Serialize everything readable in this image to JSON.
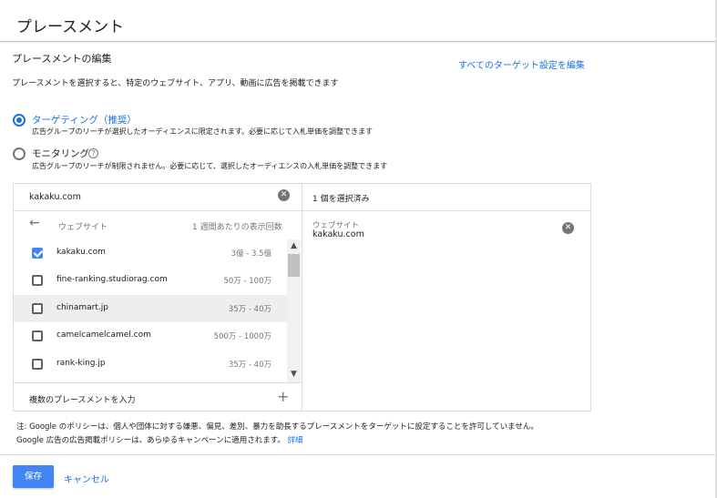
{
  "header": {
    "title": "プレースメント"
  },
  "section": {
    "heading": "プレースメントの編集",
    "edit_all_link": "すべてのターゲット設定を編集",
    "description": "プレースメントを選択すると、特定のウェブサイト、アプリ、動画に広告を掲載できます"
  },
  "targeting": {
    "options": [
      {
        "label": "ターゲティング（推奨）",
        "help": "広告グループのリーチが選択したオーディエンスに限定されます。必要に応じて入札単価を調整できます",
        "selected": true
      },
      {
        "label": "モニタリング",
        "help": "広告グループのリーチが制限されません。必要に応じて、選択したオーディエンスの入札単価を調整できます",
        "selected": false
      }
    ]
  },
  "search": {
    "value": "kakaku.com"
  },
  "results": {
    "column_website": "ウェブサイト",
    "column_impressions": "1 週間あたりの表示回数",
    "rows": [
      {
        "name": "kakaku.com",
        "impressions": "3億 - 3.5億",
        "checked": true
      },
      {
        "name": "fine-ranking.studiorag.com",
        "impressions": "50万 - 100万",
        "checked": false
      },
      {
        "name": "chinamart.jp",
        "impressions": "35万 - 40万",
        "checked": false
      },
      {
        "name": "camelcamelcamel.com",
        "impressions": "500万 - 1000万",
        "checked": false
      },
      {
        "name": "rank-king.jp",
        "impressions": "35万 - 40万",
        "checked": false
      }
    ],
    "multi_input_label": "複数のプレースメントを入力"
  },
  "selected": {
    "count_label": "1 個を選択済み",
    "items": [
      {
        "type": "ウェブサイト",
        "value": "kakaku.com"
      }
    ]
  },
  "notes": {
    "line1": "注: Google のポリシーは、個人や団体に対する嫌悪、偏見、差別、暴力を助長するプレースメントをターゲットに設定することを許可していません。",
    "line2": "Google 広告の広告掲載ポリシーは、あらゆるキャンペーンに適用されます。",
    "link": "詳細"
  },
  "footer": {
    "save": "保存",
    "cancel": "キャンセル"
  },
  "icons": {
    "back": "arrow-back-icon",
    "clear": "close-circle-icon",
    "help": "help-circle-icon",
    "plus": "plus-icon",
    "check": "check-icon",
    "scroll_up": "chevron-up-icon",
    "scroll_down": "chevron-down-icon"
  },
  "colors": {
    "accent": "#1a73e8",
    "primary_button": "#4285f4",
    "checkbox_checked": "#4285f4"
  }
}
